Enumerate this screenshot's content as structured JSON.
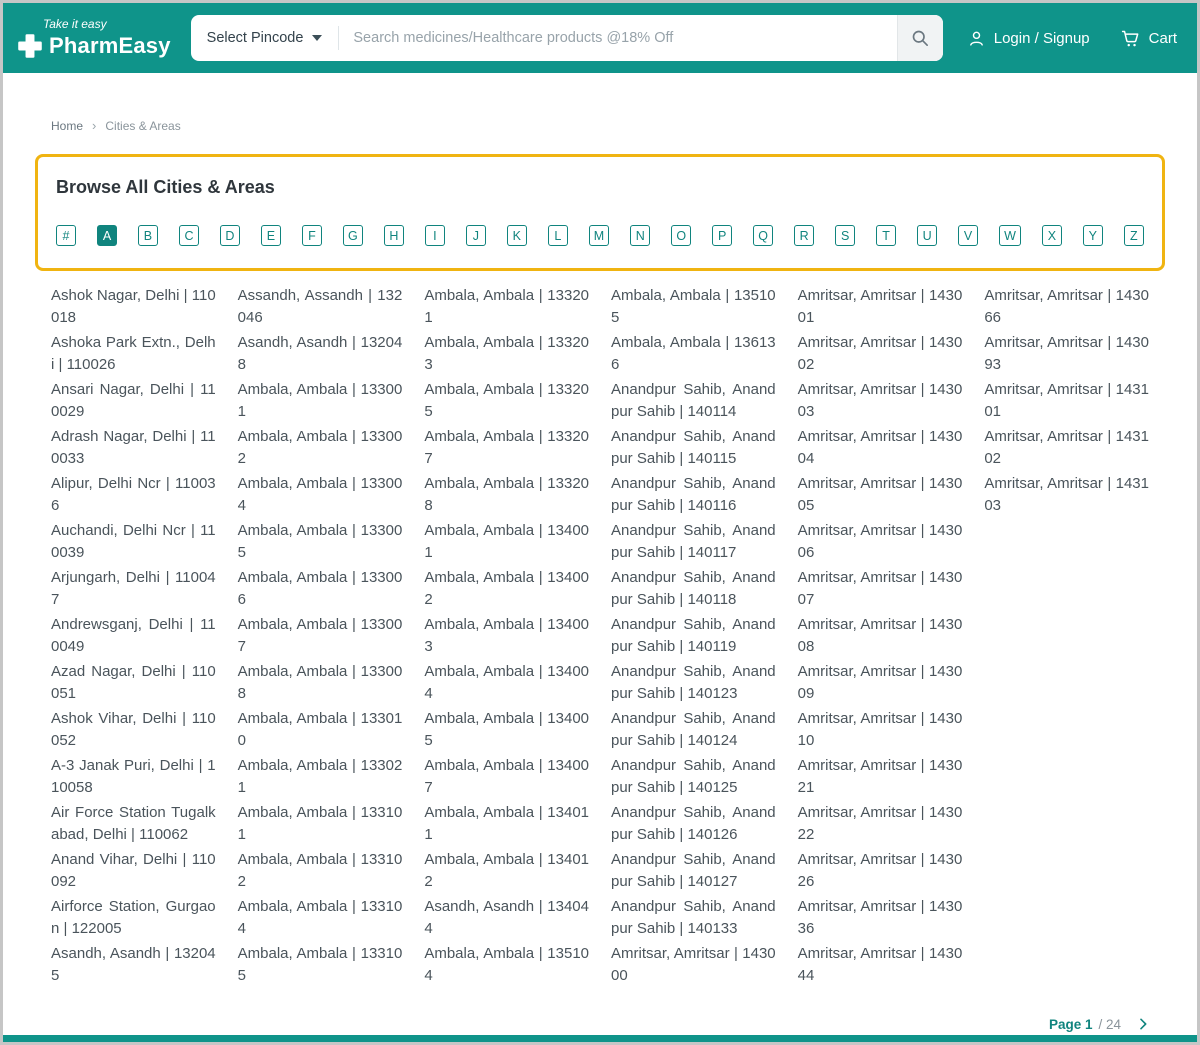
{
  "colors": {
    "header_teal": "#0F948A",
    "accent_teal": "#10847E",
    "border_gold": "#F0B411",
    "link_gray": "#4A545B"
  },
  "header": {
    "tagline": "Take it easy",
    "brand_name": "PharmEasy",
    "pincode_label": "Select Pincode",
    "search_placeholder": "Search medicines/Healthcare products @18% Off",
    "login_label": "Login / Signup",
    "cart_label": "Cart"
  },
  "breadcrumb": {
    "items": [
      {
        "label": "Home"
      },
      {
        "label": "Cities & Areas"
      }
    ],
    "separator": "›"
  },
  "browse": {
    "title": "Browse All Cities & Areas",
    "selected_letter": "A",
    "letters": [
      "#",
      "A",
      "B",
      "C",
      "D",
      "E",
      "F",
      "G",
      "H",
      "I",
      "J",
      "K",
      "L",
      "M",
      "N",
      "O",
      "P",
      "Q",
      "R",
      "S",
      "T",
      "U",
      "V",
      "W",
      "X",
      "Y",
      "Z"
    ]
  },
  "cities": {
    "columns": [
      [
        "Ashok Nagar, Delhi | 110018",
        "Ashoka Park Extn., Delhi | 110026",
        "Ansari Nagar, Delhi | 110029",
        "Adrash Nagar, Delhi | 110033",
        "Alipur, Delhi Ncr | 110036",
        "Auchandi, Delhi Ncr | 110039",
        "Arjungarh, Delhi | 110047",
        "Andrewsganj, Delhi | 110049",
        "Azad Nagar, Delhi | 110051",
        "Ashok Vihar, Delhi | 110052",
        "A-3 Janak Puri, Delhi | 110058",
        "Air Force Station Tugalkabad, Delhi | 110062",
        "Anand Vihar, Delhi | 110092",
        "Airforce Station, Gurgaon | 122005",
        "Asandh, Asandh | 132045"
      ],
      [
        "Assandh, Assandh | 132046",
        "Asandh, Asandh | 132048",
        "Ambala, Ambala | 133001",
        "Ambala, Ambala | 133002",
        "Ambala, Ambala | 133004",
        "Ambala, Ambala | 133005",
        "Ambala, Ambala | 133006",
        "Ambala, Ambala | 133007",
        "Ambala, Ambala | 133008",
        "Ambala, Ambala | 133010",
        "Ambala, Ambala | 133021",
        "Ambala, Ambala | 133101",
        "Ambala, Ambala | 133102",
        "Ambala, Ambala | 133104",
        "Ambala, Ambala | 133105"
      ],
      [
        "Ambala, Ambala | 133201",
        "Ambala, Ambala | 133203",
        "Ambala, Ambala | 133205",
        "Ambala, Ambala | 133207",
        "Ambala, Ambala | 133208",
        "Ambala, Ambala | 134001",
        "Ambala, Ambala | 134002",
        "Ambala, Ambala | 134003",
        "Ambala, Ambala | 134004",
        "Ambala, Ambala | 134005",
        "Ambala, Ambala | 134007",
        "Ambala, Ambala | 134011",
        "Ambala, Ambala | 134012",
        "Asandh, Asandh | 134044",
        "Ambala, Ambala | 135104"
      ],
      [
        "Ambala, Ambala | 135105",
        "Ambala, Ambala | 136136",
        "Anandpur Sahib, Anandpur Sahib | 140114",
        "Anandpur Sahib, Anandpur Sahib | 140115",
        "Anandpur Sahib, Anandpur Sahib | 140116",
        "Anandpur Sahib, Anandpur Sahib | 140117",
        "Anandpur Sahib, Anandpur Sahib | 140118",
        "Anandpur Sahib, Anandpur Sahib | 140119",
        "Anandpur Sahib, Anandpur Sahib | 140123",
        "Anandpur Sahib, Anandpur Sahib | 140124",
        "Anandpur Sahib, Anandpur Sahib | 140125",
        "Anandpur Sahib, Anandpur Sahib | 140126",
        "Anandpur Sahib, Anandpur Sahib | 140127",
        "Anandpur Sahib, Anandpur Sahib | 140133",
        "Amritsar, Amritsar | 143000"
      ],
      [
        "Amritsar, Amritsar | 143001",
        "Amritsar, Amritsar | 143002",
        "Amritsar, Amritsar | 143003",
        "Amritsar, Amritsar | 143004",
        "Amritsar, Amritsar | 143005",
        "Amritsar, Amritsar | 143006",
        "Amritsar, Amritsar | 143007",
        "Amritsar, Amritsar | 143008",
        "Amritsar, Amritsar | 143009",
        "Amritsar, Amritsar | 143010",
        "Amritsar, Amritsar | 143021",
        "Amritsar, Amritsar | 143022",
        "Amritsar, Amritsar | 143026",
        "Amritsar, Amritsar | 143036",
        "Amritsar, Amritsar | 143044"
      ],
      [
        "Amritsar, Amritsar | 143066",
        "Amritsar, Amritsar | 143093",
        "Amritsar, Amritsar | 143101",
        "Amritsar, Amritsar | 143102",
        "Amritsar, Amritsar | 143103"
      ]
    ]
  },
  "pagination": {
    "page_label": "Page 1",
    "total_label": "/ 24"
  }
}
